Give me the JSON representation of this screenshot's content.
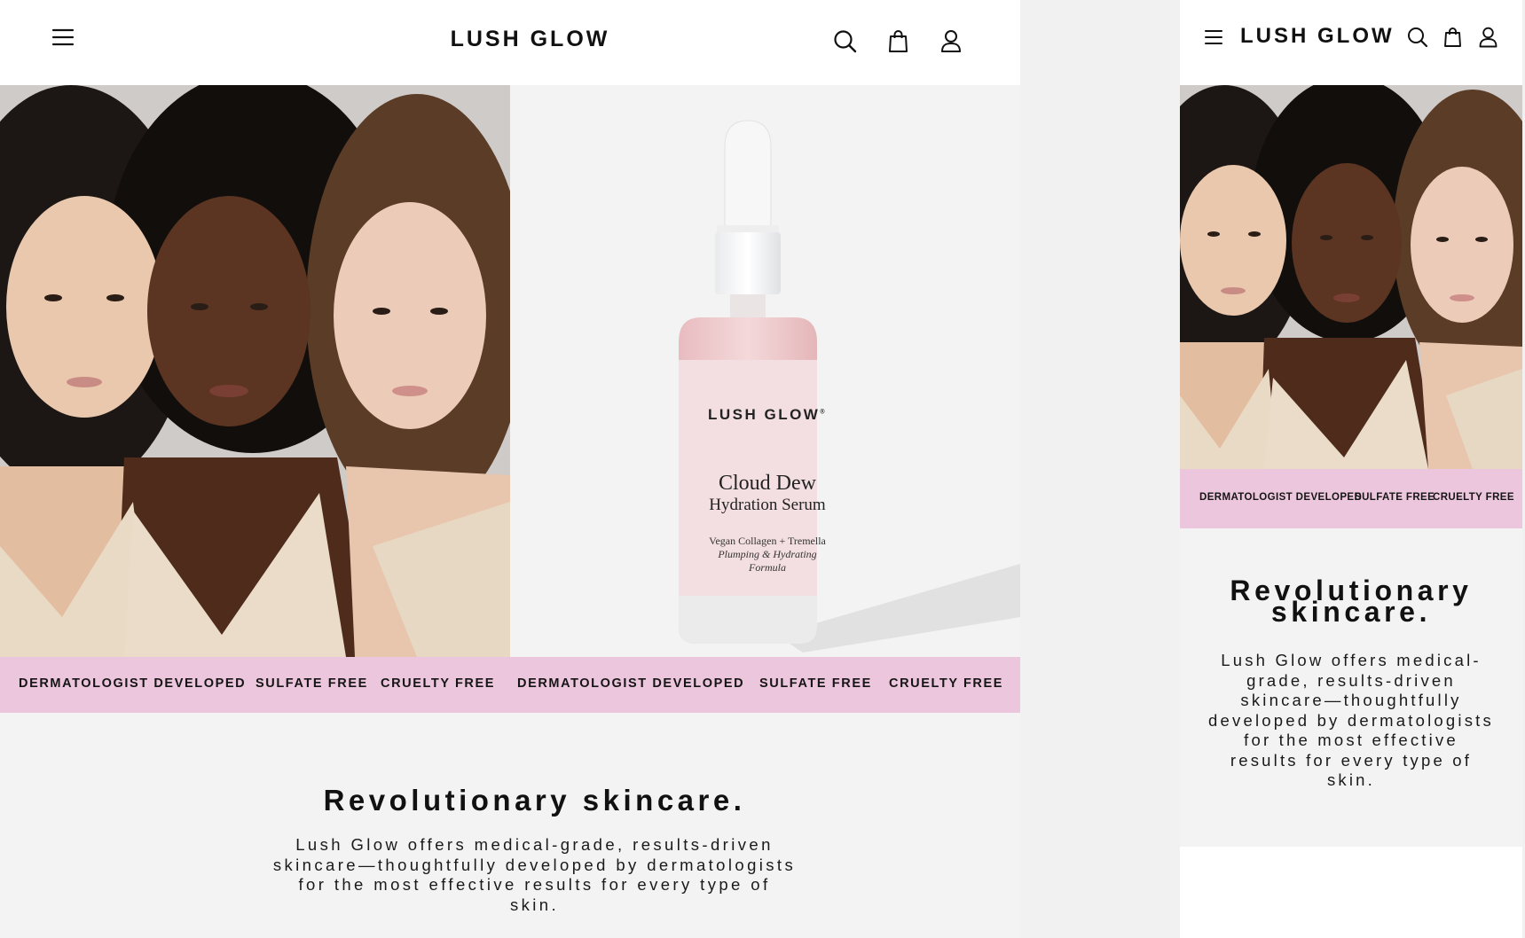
{
  "brand": {
    "name": "LUSH GLOW"
  },
  "header": {
    "menu_icon": "hamburger-menu-icon",
    "search_icon": "search-icon",
    "cart_icon": "shopping-bag-icon",
    "account_icon": "user-account-icon"
  },
  "product": {
    "brand_mark": "LUSH GLOW",
    "trademark": "®",
    "name_line1": "Cloud Dew",
    "name_line2": "Hydration Serum",
    "desc_line1": "Vegan Collagen + Tremella",
    "desc_line2": "Plumping & Hydrating",
    "desc_line3": "Formula"
  },
  "features": {
    "desktop": [
      "DERMATOLOGIST DEVELOPED",
      "SULFATE FREE",
      "CRUELTY FREE",
      "DERMATOLOGIST DEVELOPED",
      "SULFATE FREE",
      "CRUELTY FREE"
    ],
    "mobile": [
      "DERMATOLOGIST DEVELOPED",
      "SULFATE FREE",
      "CRUELTY FREE"
    ]
  },
  "intro": {
    "headline": "Revolutionary skincare.",
    "headline_mobile_line1": "Revolutionary",
    "headline_mobile_line2": "skincare.",
    "body": "Lush Glow offers medical-grade, results-driven skincare—thoughtfully developed by dermatologists for the most effective results for every type of skin.",
    "body_desktop_lines": [
      "Lush Glow offers medical-grade, results-driven",
      "skincare—thoughtfully developed by dermatologists",
      "for the most effective results for every type of",
      "skin."
    ],
    "body_mobile_lines": [
      "Lush Glow offers medical-",
      "grade, results-driven",
      "skincare—thoughtfully",
      "developed by dermatologists",
      "for the most effective",
      "results for every type of",
      "skin."
    ]
  },
  "colors": {
    "accent_pink": "#ecc6dc",
    "header_bg": "#ffffff",
    "page_bg": "#f3f3f3",
    "text": "#111111"
  }
}
